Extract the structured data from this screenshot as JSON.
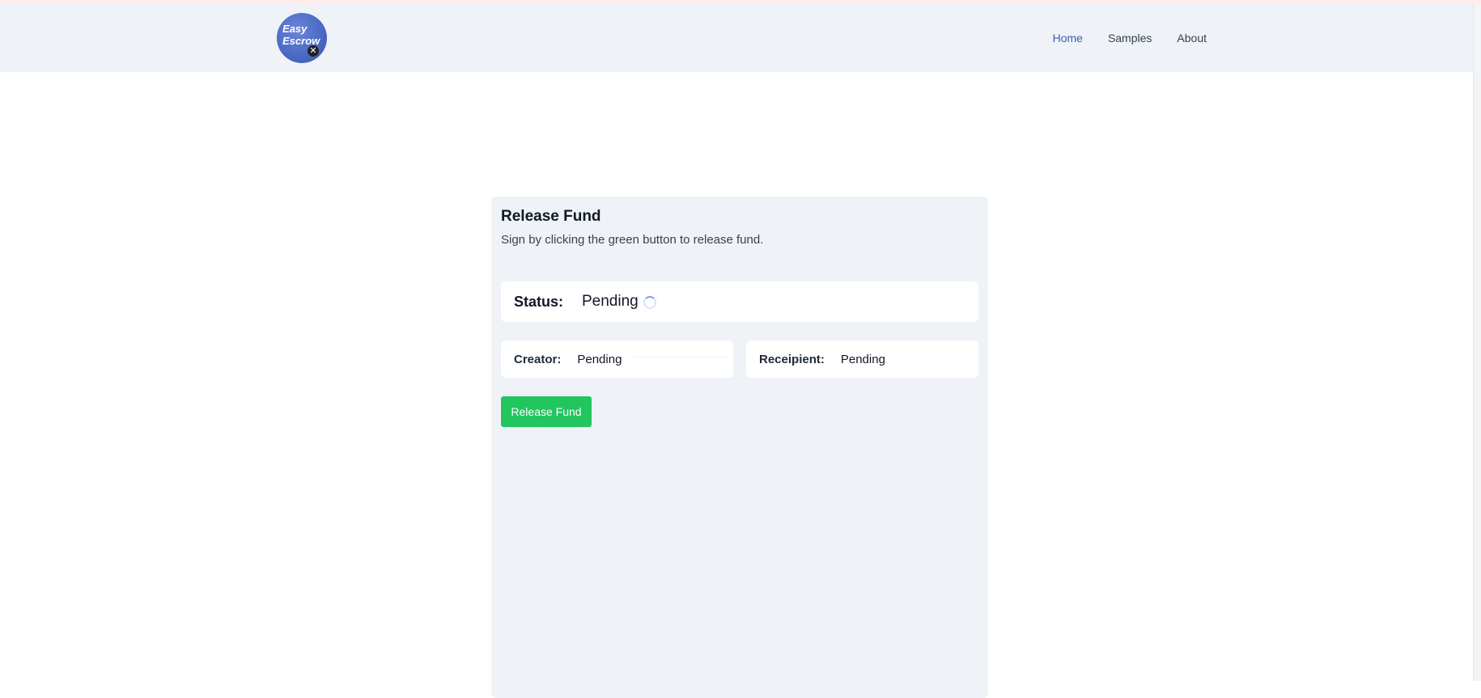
{
  "navbar": {
    "logo_line1": "Easy",
    "logo_line2": "Escrow",
    "logo_badge": "✕",
    "links": [
      {
        "label": "Home",
        "active": true
      },
      {
        "label": "Samples",
        "active": false
      },
      {
        "label": "About",
        "active": false
      }
    ]
  },
  "card": {
    "title": "Release Fund",
    "subtitle": "Sign by clicking the green button to release fund.",
    "status": {
      "label": "Status:",
      "value": "Pending"
    },
    "creator": {
      "label": "Creator:",
      "value": "Pending"
    },
    "recipient": {
      "label": "Receipient:",
      "value": "Pending"
    },
    "button_label": "Release Fund"
  },
  "colors": {
    "nav_bg": "#eff3f8",
    "accent_link": "#3b5ba9",
    "button_green": "#22c55e",
    "logo_blue": "#4a67c4"
  }
}
